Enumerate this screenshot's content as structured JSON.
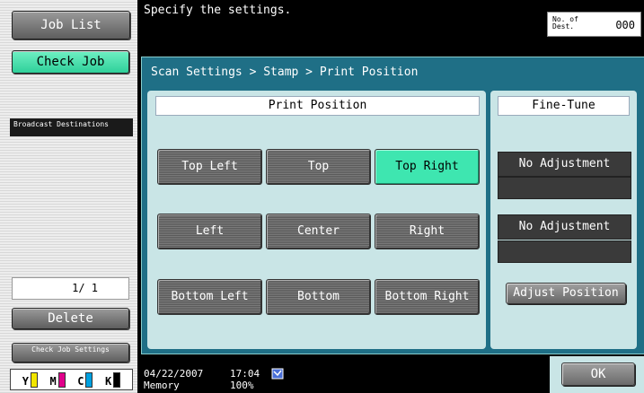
{
  "header": {
    "message": "Specify the settings.",
    "dest_label": "No. of Dest.",
    "dest_count": "000"
  },
  "sidebar": {
    "job_list": "Job List",
    "check_job": "Check Job",
    "broadcast_label": "Broadcast Destinations",
    "page_indicator": "1/ 1",
    "delete": "Delete",
    "check_job_settings": "Check Job Settings",
    "toner": [
      {
        "label": "Y",
        "color": "#f2e600"
      },
      {
        "label": "M",
        "color": "#e0008a"
      },
      {
        "label": "C",
        "color": "#00a0e0"
      },
      {
        "label": "K",
        "color": "#000000"
      }
    ]
  },
  "main": {
    "breadcrumb": "Scan Settings > Stamp > Print Position",
    "print_position_header": "Print Position",
    "fine_tune_header": "Fine-Tune",
    "positions": [
      {
        "label": "Top Left",
        "selected": false
      },
      {
        "label": "Top",
        "selected": false
      },
      {
        "label": "Top Right",
        "selected": true
      },
      {
        "label": "Left",
        "selected": false
      },
      {
        "label": "Center",
        "selected": false
      },
      {
        "label": "Right",
        "selected": false
      },
      {
        "label": "Bottom Left",
        "selected": false
      },
      {
        "label": "Bottom",
        "selected": false
      },
      {
        "label": "Bottom Right",
        "selected": false
      }
    ],
    "fine_tune_horizontal": "No Adjustment",
    "fine_tune_vertical": "No Adjustment",
    "adjust_position": "Adjust Position",
    "ok": "OK",
    "accent_color": "#3ee6b0"
  },
  "footer": {
    "date": "04/22/2007",
    "time": "17:04",
    "memory_label": "Memory",
    "memory_value": "100%"
  }
}
